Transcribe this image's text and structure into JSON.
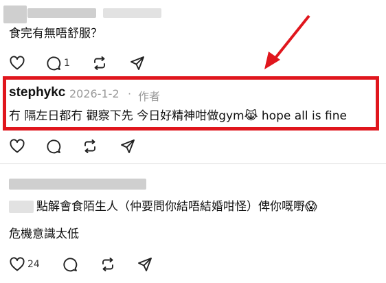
{
  "comment1": {
    "text": "食完有無唔舒服？",
    "reply_count": "1"
  },
  "comment2": {
    "author": "stephykc",
    "date": "2026-1-2",
    "separator": "·",
    "author_tag": "作者",
    "text_part1": "冇 隔左日都冇 觀察下先 今日好精神咁做gym",
    "emoji1": "😹",
    "text_part2": " hope all is fine"
  },
  "comment3": {
    "text_line1": "點解會食陌生人（仲要問你結唔結婚咁怪）俾你嘅嘢",
    "emoji": "😱",
    "text_line2": "危機意識太低",
    "like_count": "24"
  },
  "annotation": {
    "arrow_color": "#e0161d",
    "box_color": "#e0161d"
  }
}
